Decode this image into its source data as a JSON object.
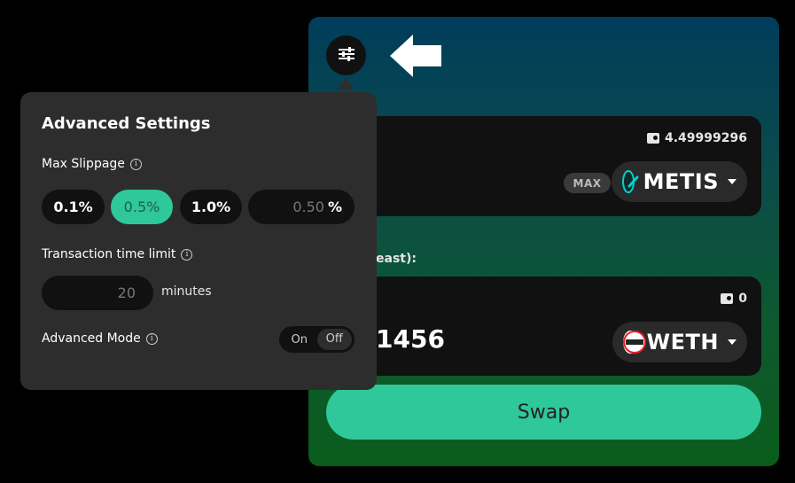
{
  "swap": {
    "from_balance": "4.49999296",
    "max_label": "MAX",
    "from_token": "METIS",
    "to_label_partial": "east):",
    "to_balance": "0",
    "to_amount_partial": "1456",
    "to_token": "WETH",
    "to_token_icon_text": "WETH",
    "swap_label": "Swap"
  },
  "settings": {
    "title": "Advanced Settings",
    "max_slippage_label": "Max Slippage",
    "slippage_options": [
      "0.1%",
      "0.5%",
      "1.0%"
    ],
    "selected_slippage": "0.5%",
    "custom_slippage_placeholder": "0.50",
    "percent_symbol": "%",
    "time_limit_label": "Transaction time limit",
    "time_limit_placeholder": "20",
    "minutes_label": "minutes",
    "advanced_mode_label": "Advanced Mode",
    "toggle_on": "On",
    "toggle_off": "Off",
    "advanced_mode_value": "Off"
  },
  "icons": {
    "settings_button": "sliders-icon",
    "arrow": "arrow-left-icon",
    "info": "info-icon",
    "wallet": "wallet-icon"
  },
  "colors": {
    "accent": "#2ec89a",
    "popup_bg": "#2d2d2d",
    "metis": "#00d3c8",
    "weth": "#ec1c24"
  }
}
